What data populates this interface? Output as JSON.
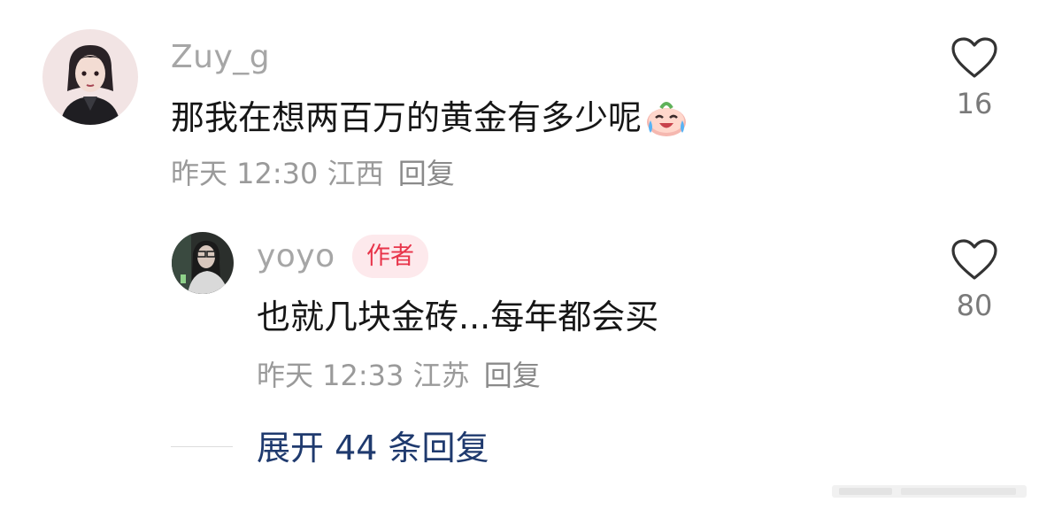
{
  "comments": [
    {
      "username": "Zuy_g",
      "text": "那我在想两百万的黄金有多少呢",
      "emoji": "laughing-crying-face",
      "time": "昨天 12:30",
      "location": "江西",
      "reply_label": "回复",
      "likes": "16"
    },
    {
      "username": "yoyo",
      "badge": "作者",
      "text": "也就几块金砖...每年都会买",
      "time": "昨天 12:33",
      "location": "江苏",
      "reply_label": "回复",
      "likes": "80"
    }
  ],
  "expand_replies": "展开 44 条回复",
  "colors": {
    "badge_bg": "#fde9ec",
    "badge_text": "#e8344a",
    "expand_link": "#1f3a6e",
    "meta_text": "#9a9a9a"
  }
}
